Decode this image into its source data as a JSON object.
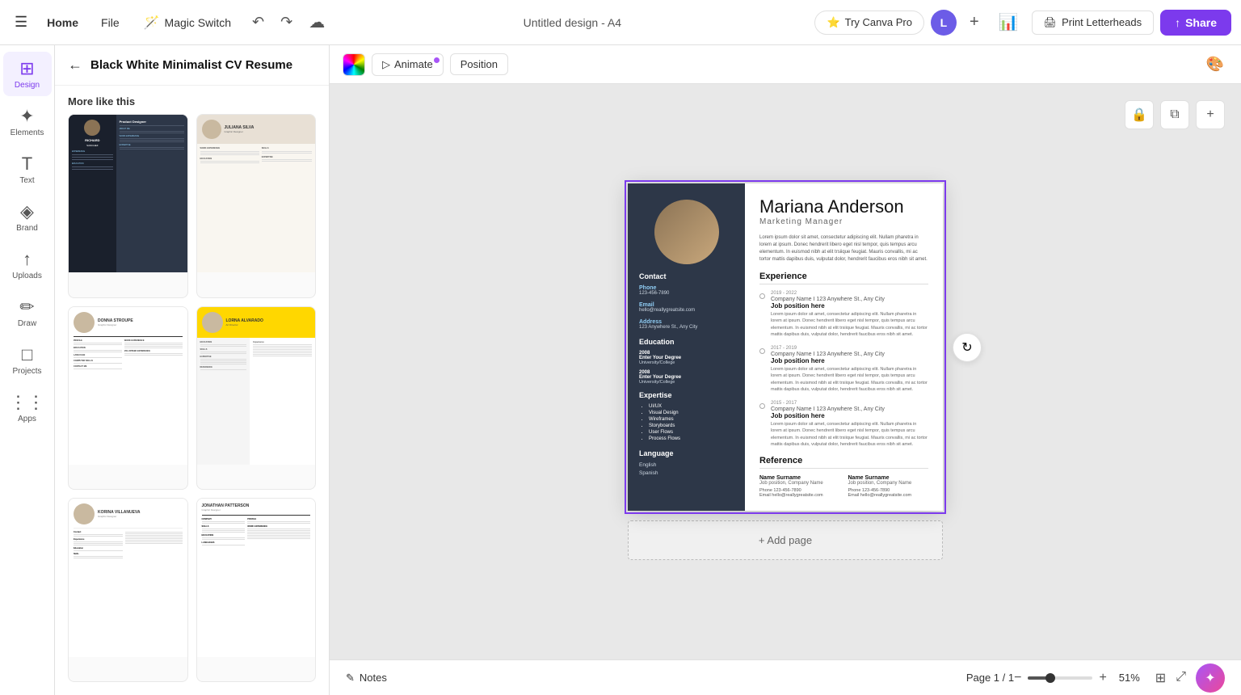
{
  "topnav": {
    "home_label": "Home",
    "file_label": "File",
    "magic_switch_label": "Magic Switch",
    "design_title": "Untitled design - A4",
    "try_canva_pro_label": "Try Canva Pro",
    "avatar_letter": "L",
    "print_label": "Print Letterheads",
    "share_label": "Share"
  },
  "sidebar": {
    "items": [
      {
        "id": "design",
        "label": "Design",
        "icon": "⊞",
        "active": true
      },
      {
        "id": "elements",
        "label": "Elements",
        "icon": "✦"
      },
      {
        "id": "text",
        "label": "Text",
        "icon": "T"
      },
      {
        "id": "brand",
        "label": "Brand",
        "icon": "◈"
      },
      {
        "id": "uploads",
        "label": "Uploads",
        "icon": "↑"
      },
      {
        "id": "draw",
        "label": "Draw",
        "icon": "✏"
      },
      {
        "id": "projects",
        "label": "Projects",
        "icon": "□"
      },
      {
        "id": "apps",
        "label": "Apps",
        "icon": "⋮⋮"
      }
    ]
  },
  "panel": {
    "back_label": "◀",
    "title": "Black White Minimalist CV Resume",
    "more_like_label": "More like this",
    "templates": [
      {
        "id": "richard",
        "name": "Richard Sanchez",
        "style": "dark"
      },
      {
        "id": "juliana",
        "name": "Juliana Silva",
        "style": "light2col"
      },
      {
        "id": "donna",
        "name": "Donna Stroupe",
        "style": "light3"
      },
      {
        "id": "lorna",
        "name": "Lorna Alvarado",
        "style": "yellow"
      },
      {
        "id": "korina",
        "name": "Korina Villanueva",
        "style": "minimal"
      },
      {
        "id": "jonathan",
        "name": "Jonathan Patterson",
        "style": "white"
      }
    ]
  },
  "canvas_toolbar": {
    "animate_label": "Animate",
    "position_label": "Position"
  },
  "cv": {
    "name_bold": "Mariana",
    "name_light": " Anderson",
    "job_title": "Marketing Manager",
    "bio": "Lorem ipsum dolor sit amet, consectetur adipiscing elit. Nullam pharetra in lorem at ipsum. Donec hendrerit libero eget nisl tempor, quis tempus arcu elementum. In euismod nibh at elit trsiique feugiat. Mauris convallis, mi ac tortor mattis dapibus duis, vulputat dolor, hendrerit faucibus eros nibh sit amet.",
    "contact_section": "Contact",
    "phone_label": "Phone",
    "phone_value": "123-456-7890",
    "email_label": "Email",
    "email_value": "hello@reallygreatsite.com",
    "address_label": "Address",
    "address_value": "123 Anywhere St., Any City",
    "education_section": "Education",
    "edu_year1": "2008",
    "edu_degree1": "Enter Your Degree",
    "edu_school1": "University/College",
    "edu_year2": "2008",
    "edu_degree2": "Enter Your Degree",
    "edu_school2": "University/College",
    "expertise_section": "Expertise",
    "expertise_items": [
      "UI/UX",
      "Visual Design",
      "Wireframes",
      "Storyboards",
      "User Flows",
      "Process Flows"
    ],
    "language_section": "Language",
    "lang_items": [
      "English",
      "Spanish"
    ],
    "experience_section": "Experience",
    "exp_items": [
      {
        "date": "2019 - 2022",
        "company": "Company Name I 123 Anywhere St., Any City",
        "role": "Job position here",
        "desc": "Lorem ipsum dolor sit amet, consectetur adipiscing elit. Nullam pharetra in lorem at ipsum. Donec hendrerit libero eget nisl tempor, quis tempus arcu elementum. In euismod nibh at elit trsiique feugiat. Mauris convallis, mi ac tortor mattis dapibus duis, vulputat dolor, hendrerit faucibus eros nibh sit amet."
      },
      {
        "date": "2017 - 2019",
        "company": "Company Name I 123 Anywhere St., Any City",
        "role": "Job position here",
        "desc": "Lorem ipsum dolor sit amet, consectetur adipiscing elit. Nullam pharetra in lorem at ipsum. Donec hendrerit libero eget nisl tempor, quis tempus arcu elementum. In euismod nibh at elit trsiique feugiat. Mauris convallis, mi ac tortor mattis dapibus duis, vulputat dolor, hendrerit faucibus eros nibh sit amet."
      },
      {
        "date": "2015 - 2017",
        "company": "Company Name I 123 Anywhere St., Any City",
        "role": "Job position here",
        "desc": "Lorem ipsum dolor sit amet, consectetur adipiscing elit. Nullam pharetra in lorem at ipsum. Donec hendrerit libero eget nisl tempor, quis tempus arcu elementum. In euismod nibh at elit trsiique feugiat. Mauris convallis, mi ac tortor mattis dapibus duis, vulputat dolor, hendrerit faucibus eros nibh sit amet."
      }
    ],
    "reference_section": "Reference",
    "ref_items": [
      {
        "name": "Name Surname",
        "subtitle": "Job position, Company Name",
        "phone": "Phone   123-456-7890",
        "email": "Email   hello@reallygreatsite.com"
      },
      {
        "name": "Name Surname",
        "subtitle": "Job position, Company Name",
        "phone": "Phone   123-456-7890",
        "email": "Email   hello@reallygreatsite.com"
      }
    ]
  },
  "canvas_actions": {
    "lock_icon": "🔒",
    "copy_icon": "⧉",
    "add_icon": "+"
  },
  "add_page_label": "+ Add page",
  "bottom": {
    "notes_label": "Notes",
    "page_info": "Page 1 / 1",
    "zoom_pct": "51%"
  },
  "colors": {
    "accent": "#7c3aed",
    "cv_dark": "#2d3748"
  }
}
